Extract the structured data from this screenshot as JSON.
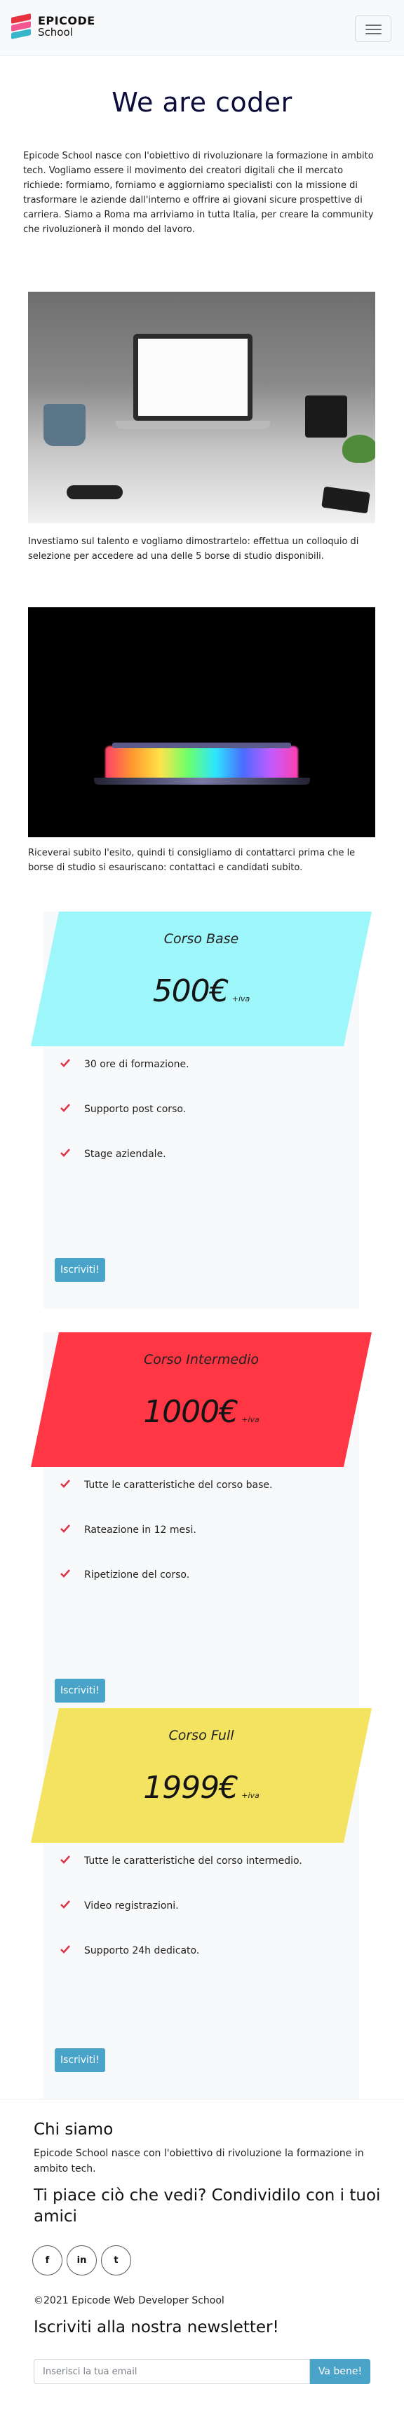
{
  "nav": {
    "brand_line1": "EPICODE",
    "brand_line2": "School",
    "toggler_icon": "hamburger-icon"
  },
  "hero": {
    "title": "We are coder",
    "intro": "Epicode School nasce con l'obiettivo di rivoluzionare la formazione in ambito tech. Vogliamo essere il movimento dei creatori digitali che il mercato richiede: formiamo, forniamo e aggiorniamo specialisti con la missione di trasformare le aziende dall'interno e offrire ai giovani sicure prospettive di carriera. Siamo a Roma ma arriviamo in tutta Italia, per creare la community che rivoluzionerà il mondo del lavoro."
  },
  "captions": {
    "first": "Investiamo sul talento e vogliamo dimostrartelo: effettua un colloquio di selezione per accedere ad una delle 5 borse di studio disponibili.",
    "second": "Riceverai subito l'esito, quindi ti consigliamo di contattarci prima che le borse di studio si esauriscano: contattaci e candidati subito."
  },
  "plans": [
    {
      "name": "Corso Base",
      "price": "500€",
      "tax": "+iva",
      "color": "#9cf6fa",
      "features": [
        "30 ore di formazione.",
        "Supporto post corso.",
        "Stage aziendale."
      ],
      "cta": "Iscriviti!"
    },
    {
      "name": "Corso Intermedio",
      "price": "1000€",
      "tax": "+iva",
      "color": "#ff3644",
      "features": [
        "Tutte le caratteristiche del corso base.",
        "Rateazione in 12 mesi.",
        "Ripetizione del corso."
      ],
      "cta": "Iscriviti!"
    },
    {
      "name": "Corso Full",
      "price": "1999€",
      "tax": "+iva",
      "color": "#f3e361",
      "features": [
        "Tutte le caratteristiche del corso intermedio.",
        "Video registrazioni.",
        "Supporto 24h dedicato."
      ],
      "cta": "Iscriviti!"
    }
  ],
  "colors": {
    "check": "#dc3545",
    "button": "#4aa3c9",
    "title": "#0c0c3a"
  },
  "footer": {
    "about_title": "Chi siamo",
    "about_text": "Epicode School nasce con l'obiettivo di rivoluzione la formazione in ambito tech.",
    "share_title": "Ti piace ciò che vedi? Condividilo con i tuoi amici",
    "socials": [
      {
        "icon": "facebook-icon",
        "glyph": "f"
      },
      {
        "icon": "linkedin-icon",
        "glyph": "in"
      },
      {
        "icon": "twitter-icon",
        "glyph": "t"
      }
    ],
    "copyright": "©2021 Epicode Web Developer School",
    "newsletter_title": "Iscriviti alla nostra newsletter!",
    "newsletter_placeholder": "Inserisci la tua email",
    "newsletter_button": "Va bene!"
  }
}
